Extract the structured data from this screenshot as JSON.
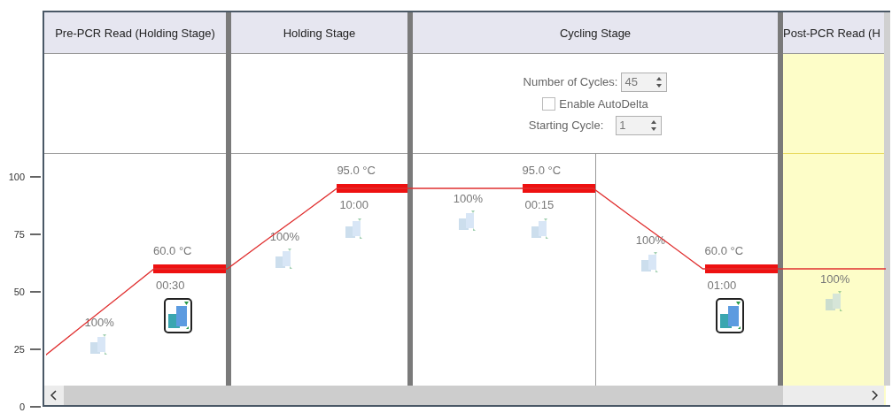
{
  "chart_data": {
    "type": "line",
    "ylim": [
      0,
      172.3
    ],
    "yticks": [
      0,
      25,
      50,
      75,
      100
    ],
    "series": [
      {
        "color": "#e03030",
        "values": [
          22,
          34.7,
          47.3,
          60,
          60,
          60,
          71.7,
          83.3,
          95,
          95,
          95,
          95,
          95,
          95,
          95,
          95,
          83.3,
          71.7,
          60,
          60,
          60,
          60,
          60,
          60
        ]
      }
    ]
  },
  "stages": [
    {
      "title": "Pre-PCR Read (Holding Stage)",
      "selected": false,
      "steps": [
        {
          "ramp": "100%",
          "ramp_collect": false,
          "temperature": "60.0 °C",
          "time": "00:30",
          "hold_collect": true
        }
      ]
    },
    {
      "title": "Holding Stage",
      "selected": false,
      "steps": [
        {
          "ramp": "100%",
          "ramp_collect": false,
          "temperature": "95.0 °C",
          "time": "10:00",
          "hold_collect": false
        }
      ]
    },
    {
      "title": "Cycling Stage",
      "selected": false,
      "settings": {
        "cycles_label": "Number of Cycles:",
        "cycles": "45",
        "autodelta_label": "Enable AutoDelta",
        "autodelta": false,
        "start_label": "Starting Cycle:",
        "start": "1"
      },
      "steps": [
        {
          "ramp": "100%",
          "ramp_collect": false,
          "temperature": "95.0 °C",
          "time": "00:15",
          "hold_collect": false
        },
        {
          "ramp": "100%",
          "ramp_collect": false,
          "temperature": "60.0 °C",
          "time": "01:00",
          "hold_collect": true
        }
      ]
    },
    {
      "title": "Post-PCR Read (H",
      "selected": true,
      "steps": [
        {
          "ramp": "100%",
          "ramp_collect": false
        }
      ]
    }
  ]
}
